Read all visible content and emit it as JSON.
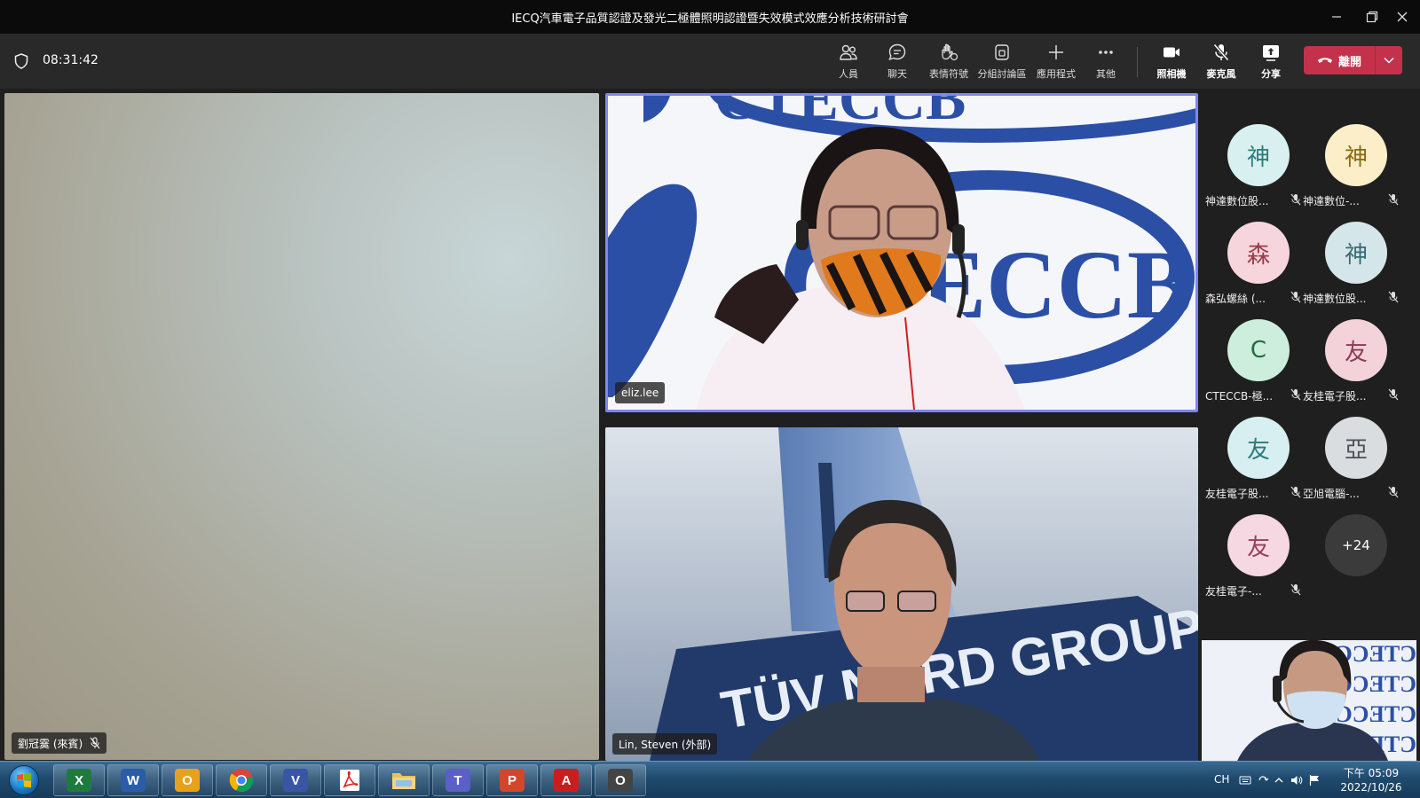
{
  "window": {
    "title": "IECQ汽車電子品質認證及發光二極體照明認證暨失效模式效應分析技術研討會"
  },
  "toolbar": {
    "meeting_time": "08:31:42",
    "buttons": [
      {
        "id": "people",
        "label": "人員"
      },
      {
        "id": "chat",
        "label": "聊天"
      },
      {
        "id": "reactions",
        "label": "表情符號"
      },
      {
        "id": "breakout",
        "label": "分組討論區"
      },
      {
        "id": "apps",
        "label": "應用程式"
      },
      {
        "id": "more",
        "label": "其他"
      },
      {
        "id": "camera",
        "label": "照相機"
      },
      {
        "id": "mic",
        "label": "麥克風"
      },
      {
        "id": "share",
        "label": "分享"
      }
    ],
    "leave_label": "離開",
    "accent_leave": "#c4314b"
  },
  "stage": {
    "left_tile_name": "劉冠霙 (來賓)",
    "speaker_tile_name": "eliz.lee",
    "speaker_backdrop_text": "CTECCB",
    "lin_tile_name": "Lin, Steven (外部)",
    "lin_backdrop_text": "TÜV NORD GROUP",
    "active_speaker_color": "#7f85f5"
  },
  "gallery": {
    "participants": [
      {
        "initial": "神",
        "name": "神達數位股...",
        "bg": "#d9f0f0",
        "fg": "#2e7d7d"
      },
      {
        "initial": "神",
        "name": "神達數位-...",
        "bg": "#fbeec8",
        "fg": "#8a6a12"
      },
      {
        "initial": "森",
        "name": "森弘螺絲 (...",
        "bg": "#f6d6dc",
        "fg": "#9a3a4a"
      },
      {
        "initial": "神",
        "name": "神達數位股...",
        "bg": "#d5e6ea",
        "fg": "#386a76"
      },
      {
        "initial": "C",
        "name": "CTECCB-極...",
        "bg": "#cdeedc",
        "fg": "#236b45"
      },
      {
        "initial": "友",
        "name": "友桂電子股...",
        "bg": "#f3d2da",
        "fg": "#8e3a50"
      },
      {
        "initial": "友",
        "name": "友桂電子股...",
        "bg": "#d7eff0",
        "fg": "#2d7a7d"
      },
      {
        "initial": "亞",
        "name": "亞旭電腦-...",
        "bg": "#d9dde0",
        "fg": "#4a5157"
      },
      {
        "initial": "友",
        "name": "友桂電子-...",
        "bg": "#f6d8e2",
        "fg": "#96405c"
      }
    ],
    "overflow_count": "+24",
    "self_backdrop_text": "CTECCB"
  },
  "taskbar": {
    "apps": [
      {
        "id": "excel",
        "glyph": "X",
        "color": "#1f7a3d"
      },
      {
        "id": "word",
        "glyph": "W",
        "color": "#2a5ca8"
      },
      {
        "id": "outlook",
        "glyph": "O",
        "color": "#e8a21a"
      },
      {
        "id": "chrome",
        "glyph": "",
        "color": "#db4437"
      },
      {
        "id": "visio",
        "glyph": "V",
        "color": "#3955a3"
      },
      {
        "id": "acrobat-reader",
        "glyph": "A",
        "color": "#e02020"
      },
      {
        "id": "explorer",
        "glyph": "",
        "color": "#e9c25a"
      },
      {
        "id": "teams",
        "glyph": "T",
        "color": "#5b5fc7"
      },
      {
        "id": "powerpoint",
        "glyph": "P",
        "color": "#d2472a"
      },
      {
        "id": "acrobat",
        "glyph": "A",
        "color": "#c81e1e"
      },
      {
        "id": "obs",
        "glyph": "O",
        "color": "#444444"
      }
    ],
    "lang": "CH",
    "time": "下午 05:09",
    "date": "2022/10/26"
  }
}
